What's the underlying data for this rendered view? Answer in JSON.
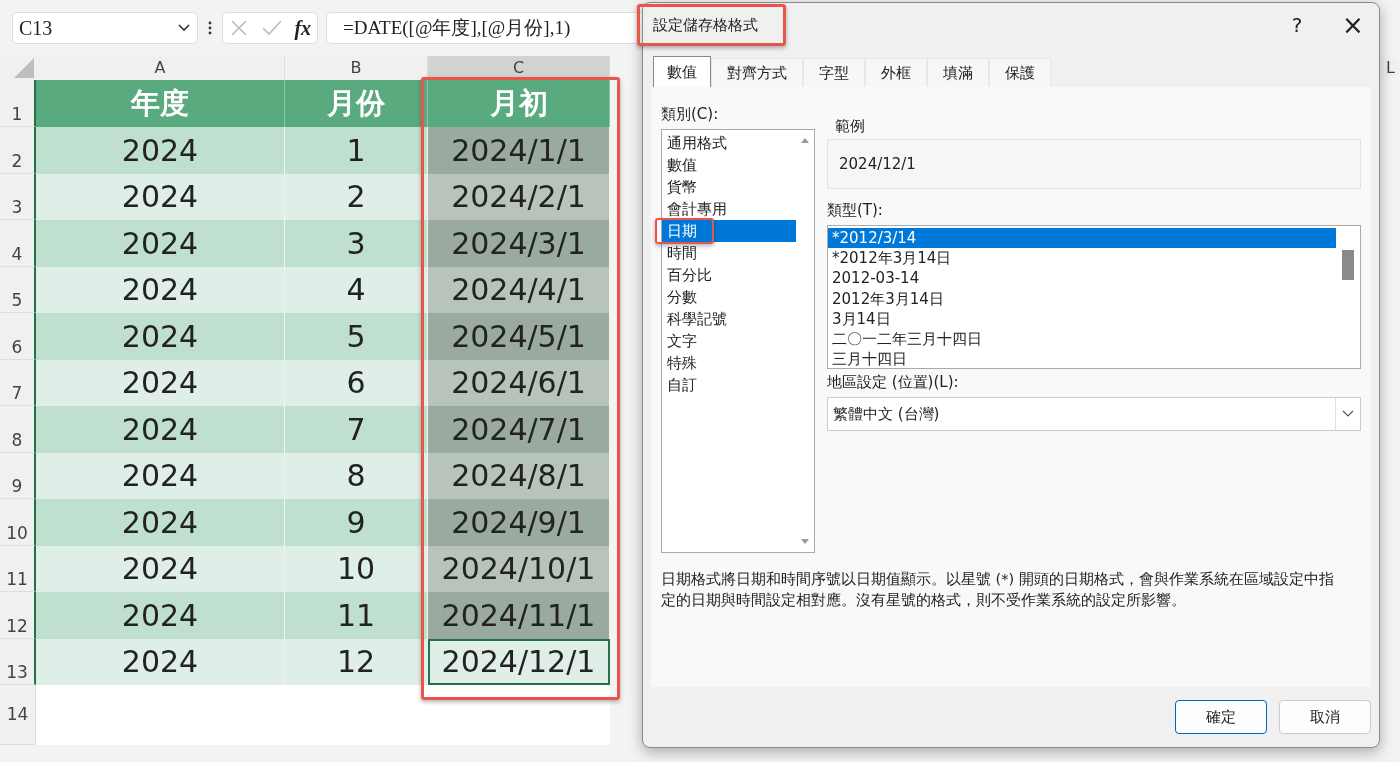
{
  "formula_bar": {
    "name_box": "C13",
    "formula": "=DATE([@年度],[@月份],1)",
    "fx": "fx"
  },
  "sheet": {
    "columns": [
      {
        "label": "A",
        "selected": false
      },
      {
        "label": "B",
        "selected": false
      },
      {
        "label": "C",
        "selected": true
      },
      {
        "label": "L",
        "selected": false
      }
    ],
    "header_row": "1",
    "headers": [
      "年度",
      "月份",
      "月初"
    ],
    "rows": [
      {
        "num": "2",
        "year": "2024",
        "month": "1",
        "first": "2024/1/1",
        "selected": true,
        "active": false
      },
      {
        "num": "3",
        "year": "2024",
        "month": "2",
        "first": "2024/2/1",
        "selected": true,
        "active": false
      },
      {
        "num": "4",
        "year": "2024",
        "month": "3",
        "first": "2024/3/1",
        "selected": true,
        "active": false
      },
      {
        "num": "5",
        "year": "2024",
        "month": "4",
        "first": "2024/4/1",
        "selected": true,
        "active": false
      },
      {
        "num": "6",
        "year": "2024",
        "month": "5",
        "first": "2024/5/1",
        "selected": true,
        "active": false
      },
      {
        "num": "7",
        "year": "2024",
        "month": "6",
        "first": "2024/6/1",
        "selected": true,
        "active": false
      },
      {
        "num": "8",
        "year": "2024",
        "month": "7",
        "first": "2024/7/1",
        "selected": true,
        "active": false
      },
      {
        "num": "9",
        "year": "2024",
        "month": "8",
        "first": "2024/8/1",
        "selected": true,
        "active": false
      },
      {
        "num": "10",
        "year": "2024",
        "month": "9",
        "first": "2024/9/1",
        "selected": true,
        "active": false
      },
      {
        "num": "11",
        "year": "2024",
        "month": "10",
        "first": "2024/10/1",
        "selected": true,
        "active": false
      },
      {
        "num": "12",
        "year": "2024",
        "month": "11",
        "first": "2024/11/1",
        "selected": true,
        "active": false
      },
      {
        "num": "13",
        "year": "2024",
        "month": "12",
        "first": "2024/12/1",
        "selected": true,
        "active": true
      }
    ],
    "empty_rows": [
      "14"
    ]
  },
  "dialog": {
    "title": "設定儲存格格式",
    "help": "?",
    "close": "×",
    "tabs": [
      {
        "label": "數值",
        "selected": true
      },
      {
        "label": "對齊方式",
        "selected": false
      },
      {
        "label": "字型",
        "selected": false
      },
      {
        "label": "外框",
        "selected": false
      },
      {
        "label": "填滿",
        "selected": false
      },
      {
        "label": "保護",
        "selected": false
      }
    ],
    "category_label": "類別(C):",
    "categories": [
      {
        "label": "通用格式",
        "selected": false
      },
      {
        "label": "數值",
        "selected": false
      },
      {
        "label": "貨幣",
        "selected": false
      },
      {
        "label": "會計專用",
        "selected": false
      },
      {
        "label": "日期",
        "selected": true
      },
      {
        "label": "時間",
        "selected": false
      },
      {
        "label": "百分比",
        "selected": false
      },
      {
        "label": "分數",
        "selected": false
      },
      {
        "label": "科學記號",
        "selected": false
      },
      {
        "label": "文字",
        "selected": false
      },
      {
        "label": "特殊",
        "selected": false
      },
      {
        "label": "自訂",
        "selected": false
      }
    ],
    "sample_label": "範例",
    "sample_value": "2024/12/1",
    "type_label": "類型(T):",
    "types": [
      {
        "label": "*2012/3/14",
        "selected": true
      },
      {
        "label": "*2012年3月14日",
        "selected": false
      },
      {
        "label": "2012-03-14",
        "selected": false
      },
      {
        "label": "2012年3月14日",
        "selected": false
      },
      {
        "label": "3月14日",
        "selected": false
      },
      {
        "label": "二〇一二年三月十四日",
        "selected": false
      },
      {
        "label": "三月十四日",
        "selected": false
      }
    ],
    "locale_label": "地區設定 (位置)(L):",
    "locale_value": "繁體中文 (台灣)",
    "description": "日期格式將日期和時間序號以日期值顯示。以星號 (*) 開頭的日期格式，會與作業系統在區域設定中指定的日期與時間設定相對應。沒有星號的格式，則不受作業系統的設定所影響。",
    "buttons": [
      {
        "label": "確定",
        "kind": "primary"
      },
      {
        "label": "取消",
        "kind": "secondary"
      }
    ]
  }
}
